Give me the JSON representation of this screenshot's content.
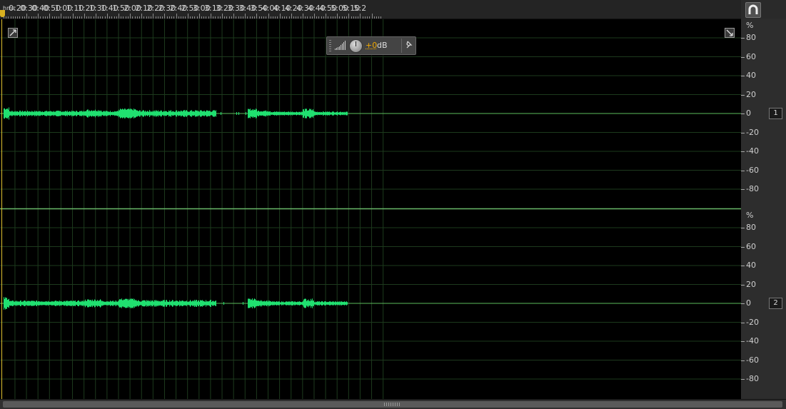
{
  "ruler": {
    "unit_label": "hms",
    "time_labels": [
      "0:20",
      "0:30",
      "0:40",
      "0:50",
      "1:00",
      "1:10",
      "1:20",
      "1:30",
      "1:40",
      "1:50",
      "2:00",
      "2:10",
      "2:20",
      "2:30",
      "2:40",
      "2:50",
      "3:00",
      "3:10",
      "3:20",
      "3:30",
      "3:40",
      "3:50",
      "4:00",
      "4:10",
      "4:20",
      "4:30",
      "4:40",
      "4:50",
      "5:00",
      "5:10",
      "5:2"
    ]
  },
  "toolbar": {
    "snap_icon": "magnet-icon"
  },
  "hud": {
    "gain_value": "+0",
    "gain_unit": "dB",
    "pin_icon": "pin-icon",
    "meter_icon": "level-meter-icon"
  },
  "channels": [
    {
      "badge": "1",
      "scale_unit": "%",
      "scale_labels": [
        "80",
        "60",
        "40",
        "20",
        "0",
        "-20",
        "-40",
        "-60",
        "-80"
      ]
    },
    {
      "badge": "2",
      "scale_unit": "%",
      "scale_labels": [
        "80",
        "60",
        "40",
        "20",
        "0",
        "-20",
        "-40",
        "-60",
        "-80"
      ]
    }
  ],
  "colors": {
    "waveform": "#20e070",
    "grid": "#1d3a1d",
    "centerline": "#5cbc5c",
    "playhead": "#e0c030",
    "hud_accent": "#f0a800"
  },
  "waveform": {
    "segments": [
      {
        "start": "0:00",
        "end": "3:09"
      },
      {
        "start": "3:32",
        "end": "4:59"
      }
    ]
  }
}
